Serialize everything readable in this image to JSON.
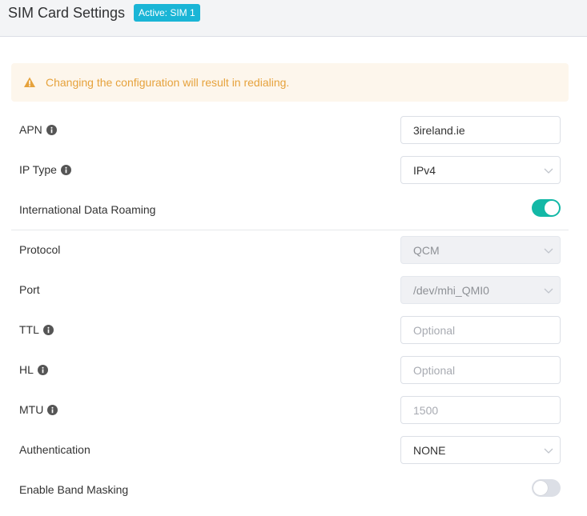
{
  "header": {
    "title": "SIM Card Settings",
    "badge": "Active: SIM 1"
  },
  "alert": {
    "message": "Changing the configuration will result in redialing."
  },
  "form": {
    "apn": {
      "label": "APN",
      "value": "3ireland.ie"
    },
    "ip_type": {
      "label": "IP Type",
      "value": "IPv4"
    },
    "roaming": {
      "label": "International Data Roaming",
      "enabled": true
    },
    "protocol": {
      "label": "Protocol",
      "value": "QCM"
    },
    "port": {
      "label": "Port",
      "value": "/dev/mhi_QMI0"
    },
    "ttl": {
      "label": "TTL",
      "placeholder": "Optional"
    },
    "hl": {
      "label": "HL",
      "placeholder": "Optional"
    },
    "mtu": {
      "label": "MTU",
      "placeholder": "1500"
    },
    "authentication": {
      "label": "Authentication",
      "value": "NONE"
    },
    "band_masking": {
      "label": "Enable Band Masking",
      "enabled": false
    }
  },
  "colors": {
    "accent": "#13b8a6",
    "badge": "#1ab5d6",
    "warning": "#e6a23c"
  },
  "icons": {
    "alert": "warning-triangle-icon",
    "info": "info-circle-icon",
    "dropdown": "chevron-down-icon"
  }
}
